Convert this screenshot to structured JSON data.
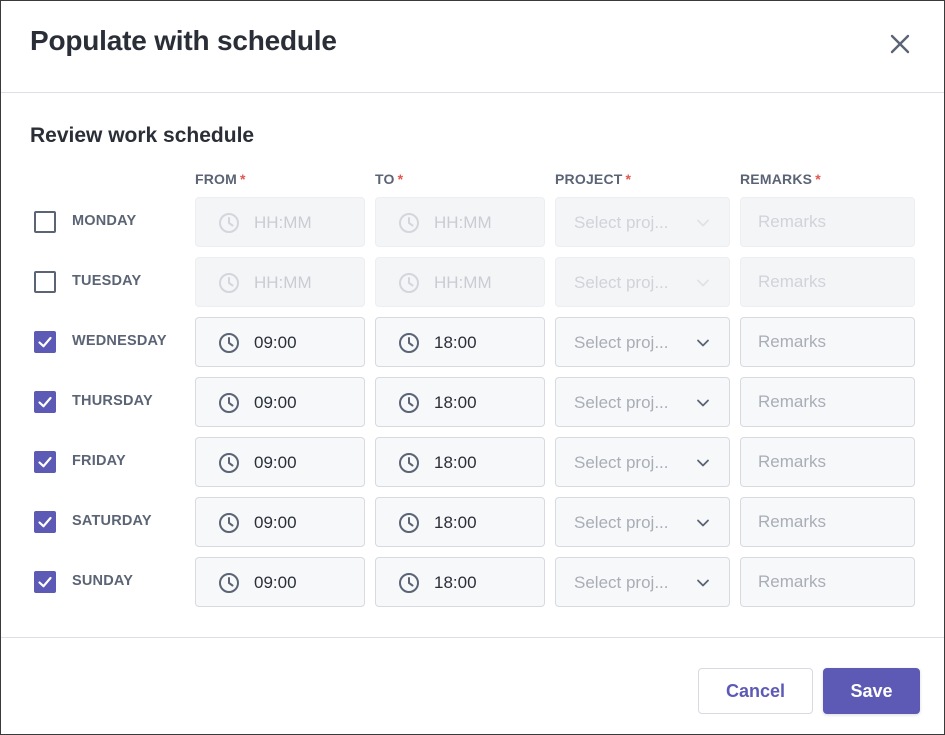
{
  "dialog": {
    "title": "Populate with schedule",
    "section_title": "Review work schedule"
  },
  "columns": {
    "from": "FROM",
    "to": "TO",
    "project": "PROJECT",
    "remarks": "REMARKS",
    "required_mark": "*"
  },
  "rows": [
    {
      "day": "MONDAY",
      "checked": false,
      "from": "HH:MM",
      "to": "HH:MM",
      "project_placeholder": "Select proj...",
      "remarks_placeholder": "Remarks"
    },
    {
      "day": "TUESDAY",
      "checked": false,
      "from": "HH:MM",
      "to": "HH:MM",
      "project_placeholder": "Select proj...",
      "remarks_placeholder": "Remarks"
    },
    {
      "day": "WEDNESDAY",
      "checked": true,
      "from": "09:00",
      "to": "18:00",
      "project_placeholder": "Select proj...",
      "remarks_placeholder": "Remarks"
    },
    {
      "day": "THURSDAY",
      "checked": true,
      "from": "09:00",
      "to": "18:00",
      "project_placeholder": "Select proj...",
      "remarks_placeholder": "Remarks"
    },
    {
      "day": "FRIDAY",
      "checked": true,
      "from": "09:00",
      "to": "18:00",
      "project_placeholder": "Select proj...",
      "remarks_placeholder": "Remarks"
    },
    {
      "day": "SATURDAY",
      "checked": true,
      "from": "09:00",
      "to": "18:00",
      "project_placeholder": "Select proj...",
      "remarks_placeholder": "Remarks"
    },
    {
      "day": "SUNDAY",
      "checked": true,
      "from": "09:00",
      "to": "18:00",
      "project_placeholder": "Select proj...",
      "remarks_placeholder": "Remarks"
    }
  ],
  "buttons": {
    "cancel": "Cancel",
    "save": "Save"
  },
  "icons": {
    "close": "close-icon",
    "clock": "clock-icon",
    "chevron": "chevron-down-icon",
    "check": "check-icon"
  },
  "colors": {
    "accent": "#5c5ab5",
    "required": "#e0584f",
    "label": "#5b6475"
  }
}
